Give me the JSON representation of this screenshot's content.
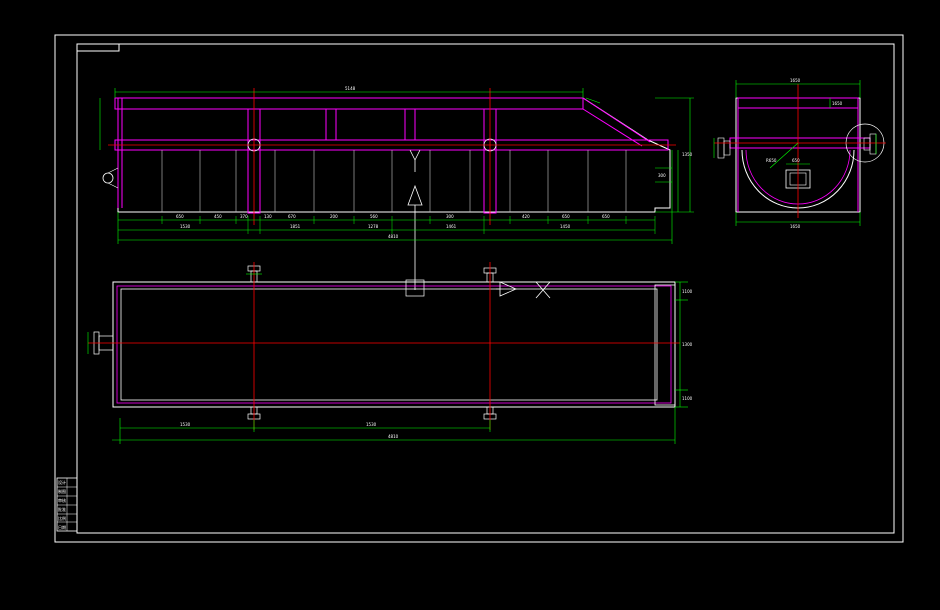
{
  "drawing": {
    "colors": {
      "background": "#000000",
      "border": "#ffffff",
      "outline": "#ffffff",
      "structure": "#ff00ff",
      "centerline": "#ff0000",
      "dimension": "#00ff00",
      "thin": "#c8c8c8"
    },
    "front_view": {
      "dims_top": [
        "5148"
      ],
      "dims_bottom_row1": [
        "650",
        "450",
        "370",
        "130",
        "670",
        "200",
        "560",
        "300",
        "420",
        "650",
        "650"
      ],
      "dims_bottom_row2": [
        "1530",
        "1851",
        "1278",
        "1461",
        "1450"
      ],
      "dims_bottom_total": [
        "4810"
      ],
      "dims_right": [
        "1350",
        "300"
      ]
    },
    "side_view": {
      "dims": [
        "1650",
        "650",
        "R650",
        "1650",
        "1650"
      ]
    },
    "plan_view": {
      "dims_bottom": [
        "1530",
        "1530"
      ],
      "dims_bottom_total": [
        "4810"
      ],
      "dims_right": [
        "1100",
        "1300",
        "1100"
      ]
    },
    "title_block": {
      "rows": [
        "设计",
        "制图",
        "审核",
        "批准",
        "比例",
        "日期"
      ]
    }
  }
}
